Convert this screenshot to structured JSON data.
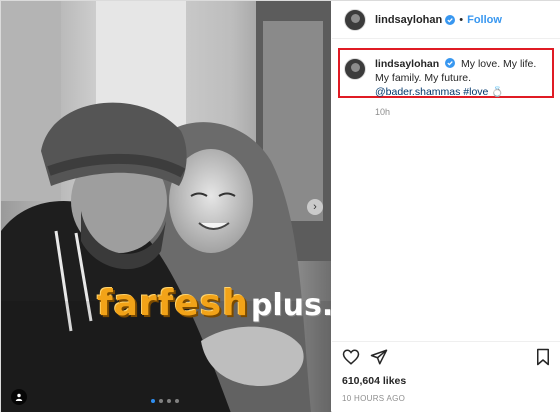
{
  "post": {
    "author": {
      "username": "lindsaylohan",
      "verified": true,
      "follow_label": "Follow",
      "separator": "•"
    },
    "caption": {
      "username": "lindsaylohan",
      "text": "My love. My life. My family. My future.",
      "mention": "@bader.shammas",
      "hashtag": "#love",
      "emoji": "💍"
    },
    "caption_age": "10h",
    "likes": "610,604 likes",
    "posted_time": "10 HOURS AGO",
    "carousel": {
      "count": 4,
      "active_index": 0
    },
    "icons": [
      "heart-icon",
      "share-icon",
      "bookmark-icon",
      "verified-icon",
      "next-arrow-icon",
      "tag-user-icon"
    ]
  },
  "watermark": {
    "main": "farfesh",
    "sub": "plus.com"
  },
  "colors": {
    "follow": "#3897f0",
    "highlight_box": "#e01b24",
    "link": "#00376b",
    "watermark": "#f2a318"
  }
}
